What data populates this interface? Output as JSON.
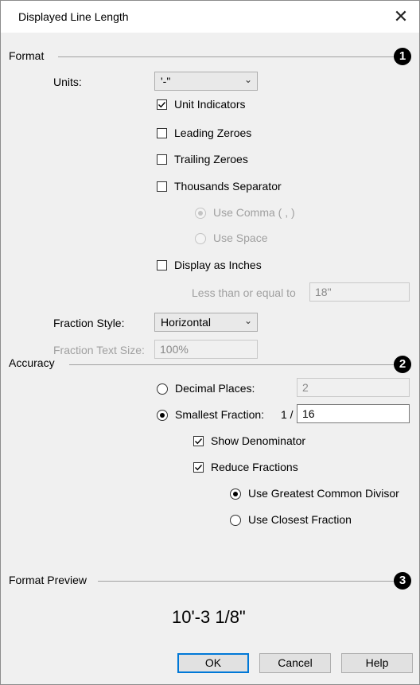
{
  "window": {
    "title": "Displayed Line Length",
    "close_glyph": "✕"
  },
  "format": {
    "section_label": "Format",
    "callout": "1",
    "units_label": "Units:",
    "units_value": "'-\"",
    "unit_indicators": {
      "label": "Unit Indicators",
      "checked": true
    },
    "leading_zeroes": {
      "label": "Leading Zeroes",
      "checked": false
    },
    "trailing_zeroes": {
      "label": "Trailing Zeroes",
      "checked": false
    },
    "thousands_separator": {
      "label": "Thousands Separator",
      "checked": false
    },
    "use_comma": {
      "label": "Use Comma ( , )",
      "selected": true,
      "enabled": false
    },
    "use_space": {
      "label": "Use Space",
      "selected": false,
      "enabled": false
    },
    "display_as_inches": {
      "label": "Display as Inches",
      "checked": false
    },
    "less_than_label": "Less than or equal to",
    "less_than_value": "18\"",
    "fraction_style_label": "Fraction Style:",
    "fraction_style_value": "Horizontal",
    "fraction_text_size_label": "Fraction Text Size:",
    "fraction_text_size_value": "100%"
  },
  "accuracy": {
    "section_label": "Accuracy",
    "callout": "2",
    "decimal_places": {
      "label": "Decimal Places:",
      "selected": false,
      "value": "2"
    },
    "smallest_fraction": {
      "label": "Smallest Fraction:",
      "selected": true,
      "prefix": "1 /",
      "value": "16"
    },
    "show_denominator": {
      "label": "Show Denominator",
      "checked": true
    },
    "reduce_fractions": {
      "label": "Reduce Fractions",
      "checked": true
    },
    "use_gcd": {
      "label": "Use Greatest Common Divisor",
      "selected": true
    },
    "use_closest": {
      "label": "Use Closest Fraction",
      "selected": false
    }
  },
  "preview": {
    "section_label": "Format Preview",
    "callout": "3",
    "text": "10'-3 1/8\""
  },
  "buttons": {
    "ok": "OK",
    "cancel": "Cancel",
    "help": "Help"
  }
}
